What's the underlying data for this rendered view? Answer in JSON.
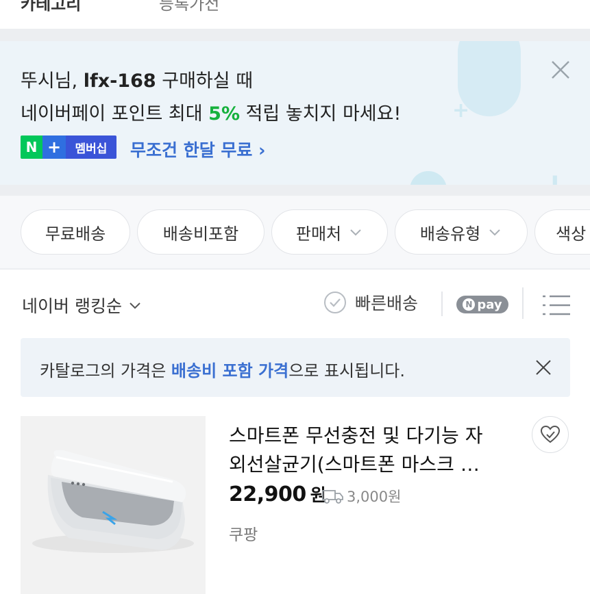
{
  "top_strip": {
    "left_text": "카테고리",
    "right_text": "등록가전"
  },
  "banner": {
    "line1_prefix": "뚜시님, ",
    "line1_product": "lfx-168",
    "line1_suffix": " 구매하실 때",
    "line2_prefix": "네이버페이 포인트 최대 ",
    "line2_percent": "5%",
    "line2_suffix": " 적립 놓치지 마세요!",
    "badge_n": "N",
    "badge_plus": "+",
    "badge_member": "멤버십",
    "link_text": "무조건 한달 무료 ›",
    "close_icon": "close-icon"
  },
  "filters": {
    "chips": [
      {
        "label": "무료배송",
        "has_dropdown": false
      },
      {
        "label": "배송비포함",
        "has_dropdown": false
      },
      {
        "label": "판매처",
        "has_dropdown": true
      },
      {
        "label": "배송유형",
        "has_dropdown": true
      },
      {
        "label": "색상",
        "has_dropdown": false
      }
    ]
  },
  "sort_bar": {
    "sort_label": "네이버 랭킹순",
    "fast_delivery_label": "빠른배송",
    "npay_label": "pay",
    "npay_n": "N"
  },
  "notice": {
    "prefix": "카탈로그의 가격은 ",
    "highlight": "배송비 포함 가격",
    "suffix": "으로 표시됩니다."
  },
  "product": {
    "title_line1": "스마트폰 무선충전 및 다기능 자",
    "title_line2": "외선살균기(스마트폰 마스크 …",
    "price": "22,900",
    "price_unit": "원",
    "shipping_fee": "3,000원",
    "seller": "쿠팡"
  },
  "colors": {
    "accent_green": "#16b13d",
    "link_blue": "#3a6fd1",
    "naver_green": "#03c75a"
  }
}
